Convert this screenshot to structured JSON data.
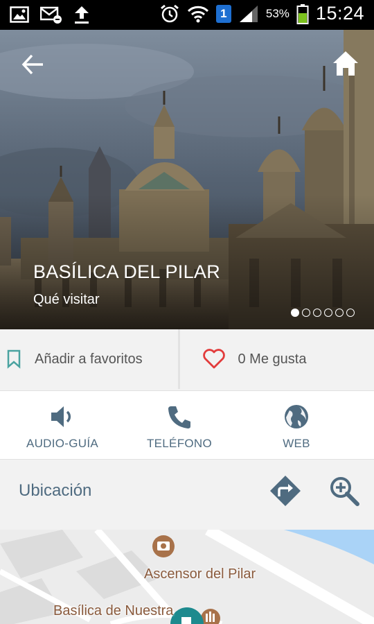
{
  "status_bar": {
    "battery_percent": "53%",
    "time": "15:24",
    "sim_badge": "1",
    "icons": [
      "image-icon",
      "mail-icon",
      "upload-icon",
      "alarm-icon",
      "wifi-icon",
      "signal-icon",
      "battery-icon"
    ]
  },
  "hero": {
    "title": "BASÍLICA DEL PILAR",
    "subtitle": "Qué visitar",
    "carousel_total": 6,
    "carousel_active": 1
  },
  "actions": {
    "favorites_label": "Añadir a favoritos",
    "likes_label": "0 Me gusta"
  },
  "tools": {
    "audio_label": "AUDIO-GUÍA",
    "phone_label": "TELÉFONO",
    "web_label": "WEB"
  },
  "location": {
    "label": "Ubicación"
  },
  "map": {
    "poi_1": "Ascensor del Pilar",
    "poi_2": "Basílica de Nuestra"
  },
  "colors": {
    "accent_teal": "#4aa3a0",
    "heart_red": "#e23b3b",
    "icon_slate": "#4f6b80",
    "map_water": "#aad3f7",
    "map_marker_teal": "#1d8a8e"
  }
}
